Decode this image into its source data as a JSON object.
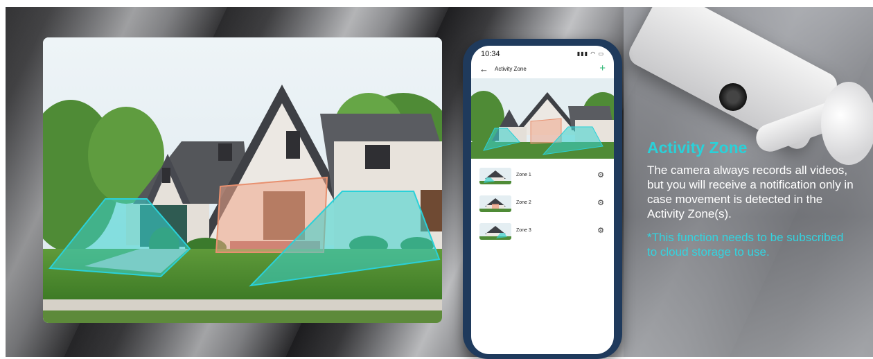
{
  "info": {
    "heading": "Activity Zone",
    "description": "The camera always records all videos, but you will receive a notification only in case movement is detected in the Activity Zone(s).",
    "note": "*This function needs to be subscribed to cloud storage to use.",
    "accent_color": "#2ad1d9"
  },
  "phone": {
    "status_time": "10:34",
    "status_icons": "4G signal wifi battery",
    "title": "Activity Zone",
    "back_icon": "back-arrow-icon",
    "add_icon": "plus-icon",
    "add_color": "#2bb673",
    "zones": [
      {
        "label": "Zone 1",
        "icon": "gear-icon"
      },
      {
        "label": "Zone 2",
        "icon": "gear-icon"
      },
      {
        "label": "Zone 3",
        "icon": "gear-icon"
      }
    ]
  },
  "photo": {
    "zone_colors": {
      "left": "#39d3d0",
      "center": "#f0a58a",
      "right": "#39d3d0"
    }
  }
}
